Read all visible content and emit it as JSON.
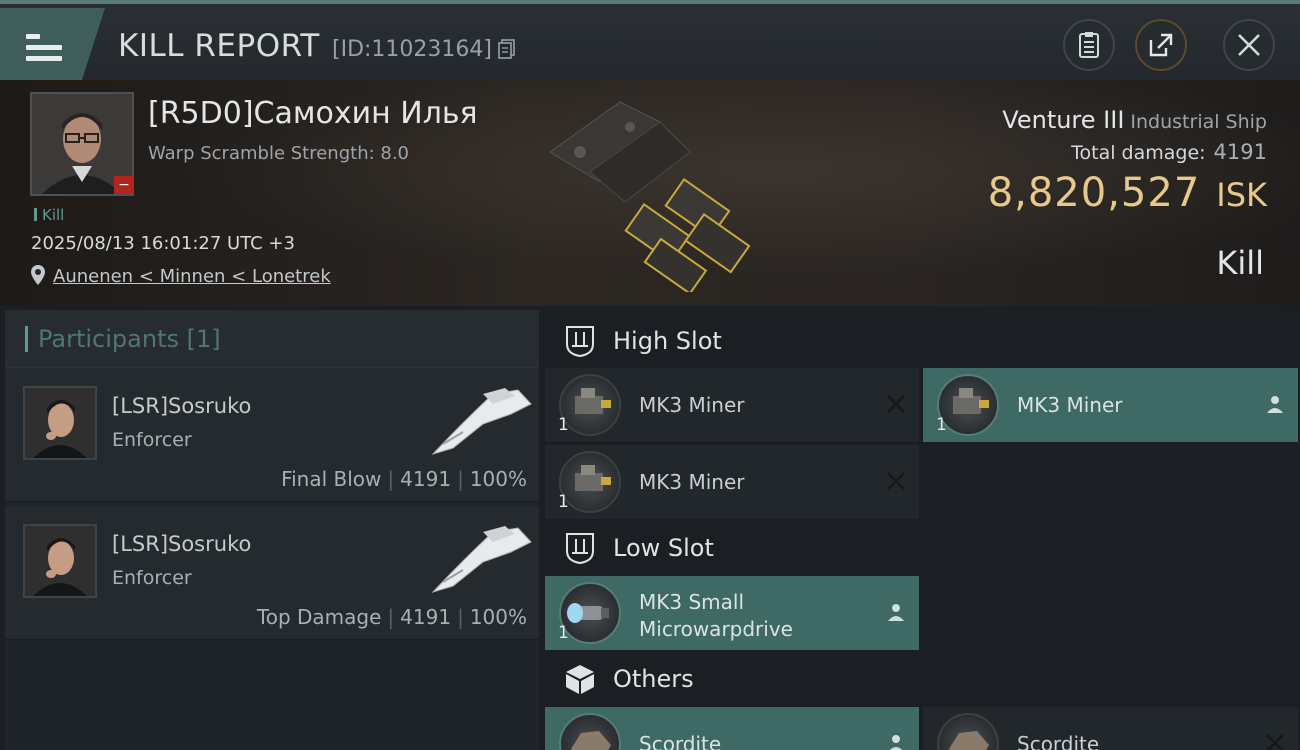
{
  "header": {
    "title": "KILL REPORT",
    "report_id": "[ID:11023164]",
    "icons": [
      "menu-icon",
      "copy-icon",
      "clipboard-icon",
      "share-icon",
      "close-icon"
    ]
  },
  "victim": {
    "name": "[R5D0]Самохин Илья",
    "warp_scramble": "Warp Scramble Strength: 8.0",
    "tag": "Kill",
    "timestamp": "2025/08/13 16:01:27 UTC +3",
    "location": "Aunenen < Minnen < Lonetrek",
    "ship": "Venture III",
    "ship_class": "Industrial Ship",
    "total_damage_label": "Total damage:",
    "total_damage": "4191",
    "isk_value": "8,820,527",
    "isk_unit": "ISK",
    "result": "Kill"
  },
  "participants": {
    "header": "Participants [1]",
    "cards": [
      {
        "name": "[LSR]Sosruko",
        "ship": "Enforcer",
        "label": "Final Blow",
        "damage": "4191",
        "percent": "100%"
      },
      {
        "name": "[LSR]Sosruko",
        "ship": "Enforcer",
        "label": "Top Damage",
        "damage": "4191",
        "percent": "100%"
      }
    ]
  },
  "slots": {
    "high": {
      "label": "High Slot",
      "modules": [
        {
          "name": "MK3 Miner",
          "qty": "1",
          "status": "destroyed"
        },
        {
          "name": "MK3 Miner",
          "qty": "1",
          "status": "dropped"
        },
        {
          "name": "MK3 Miner",
          "qty": "1",
          "status": "destroyed"
        }
      ]
    },
    "low": {
      "label": "Low Slot",
      "modules": [
        {
          "name": "MK3 Small Microwarpdrive",
          "qty": "1",
          "status": "dropped"
        }
      ]
    },
    "others": {
      "label": "Others",
      "modules": [
        {
          "name": "Scordite",
          "status": "dropped"
        },
        {
          "name": "Scordite",
          "status": "destroyed"
        }
      ]
    }
  },
  "colors": {
    "accent_teal": "#3f6964",
    "isk_gold": "#e8c98a",
    "destroy_red": "#b3241c"
  }
}
